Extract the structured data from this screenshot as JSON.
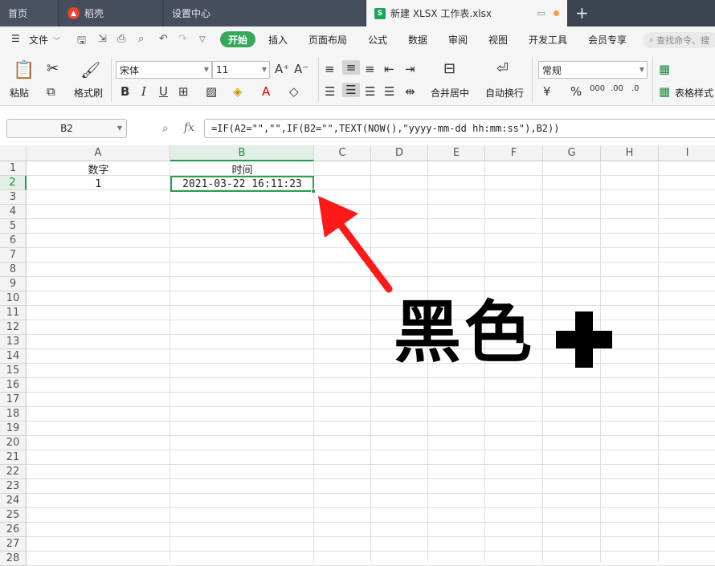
{
  "window_tabs": [
    {
      "label": "首页"
    },
    {
      "label": "稻壳"
    },
    {
      "label": "设置中心"
    },
    {
      "label": "新建 XLSX 工作表.xlsx"
    }
  ],
  "new_tab": "+",
  "menu": {
    "file_label": "文件",
    "items": [
      "开始",
      "插入",
      "页面布局",
      "公式",
      "数据",
      "审阅",
      "视图",
      "开发工具",
      "会员专享"
    ],
    "search_placeholder": "查找命令、搜"
  },
  "ribbon": {
    "paste": "粘贴",
    "format_painter": "格式刷",
    "font_name": "宋体",
    "font_size": "11",
    "merge_center": "合并居中",
    "wrap_text": "自动换行",
    "number_format": "常规",
    "table_style": "表格样式"
  },
  "formula_bar": {
    "name_box": "B2",
    "fx": "fx",
    "formula": "=IF(A2=\"\",\"\",IF(B2=\"\",TEXT(NOW(),\"yyyy-mm-dd hh:mm:ss\"),B2))"
  },
  "grid": {
    "columns": [
      "A",
      "B",
      "C",
      "D",
      "E",
      "F",
      "G",
      "H",
      "I"
    ],
    "rows": [
      "1",
      "2",
      "3",
      "4",
      "5",
      "6",
      "7",
      "8",
      "9",
      "10",
      "11",
      "12",
      "13",
      "14",
      "15",
      "16",
      "17",
      "18",
      "19",
      "20",
      "21",
      "22",
      "23",
      "24",
      "25",
      "26",
      "27",
      "28"
    ],
    "selected_cell": "B2",
    "cells": {
      "A1": "数字",
      "B1": "时间",
      "A2": "1",
      "B2": "2021-03-22 16:11:23"
    }
  },
  "annotation": {
    "text": "黑色",
    "plus_color": "#000000",
    "arrow_color": "#ff1a1a"
  },
  "colors": {
    "accent_green": "#36a85a",
    "tabbar_bg": "#3b4250"
  }
}
